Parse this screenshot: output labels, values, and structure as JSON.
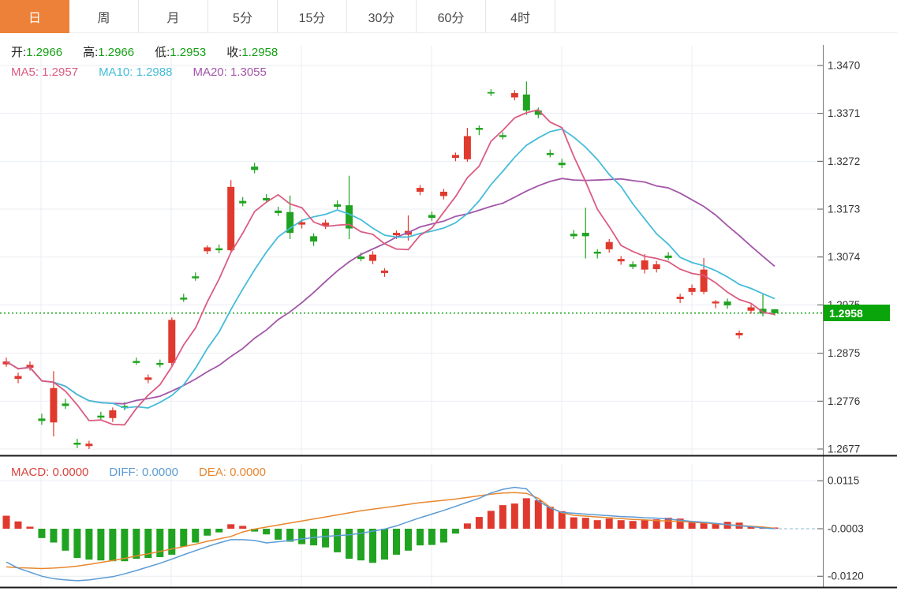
{
  "tabs": [
    {
      "id": "day",
      "label": "日",
      "active": true
    },
    {
      "id": "week",
      "label": "周",
      "active": false
    },
    {
      "id": "month",
      "label": "月",
      "active": false
    },
    {
      "id": "5min",
      "label": "5分",
      "active": false
    },
    {
      "id": "15min",
      "label": "15分",
      "active": false
    },
    {
      "id": "30min",
      "label": "30分",
      "active": false
    },
    {
      "id": "60min",
      "label": "60分",
      "active": false
    },
    {
      "id": "4hour",
      "label": "4时",
      "active": false
    }
  ],
  "legend": {
    "ohlc": [
      {
        "label": "开:",
        "value": "1.2966"
      },
      {
        "label": "高:",
        "value": "1.2966"
      },
      {
        "label": "低:",
        "value": "1.2953"
      },
      {
        "label": "收:",
        "value": "1.2958"
      }
    ],
    "ma": [
      {
        "label": "MA5:",
        "value": "1.2957",
        "color": "#db5c81"
      },
      {
        "label": "MA10:",
        "value": "1.2988",
        "color": "#45bcd9"
      },
      {
        "label": "MA20:",
        "value": "1.3055",
        "color": "#a256a8"
      }
    ],
    "macd": [
      {
        "label": "MACD:",
        "value": "0.0000",
        "color": "#d8453c"
      },
      {
        "label": "DIFF:",
        "value": "0.0000",
        "color": "#5b9bd5"
      },
      {
        "label": "DEA:",
        "value": "0.0000",
        "color": "#e8872e"
      }
    ]
  },
  "price_tag": "1.2958",
  "colors": {
    "up": "#e0392e",
    "down": "#20a320",
    "ma5": "#db5c81",
    "ma10": "#45bcd9",
    "ma20": "#a256a8",
    "diff": "#5b9bd5",
    "dea": "#e8872e",
    "tag": "#0aa50a",
    "grid": "#e9edf2",
    "axis_text": "#333333",
    "ohlc_value": "#16a016",
    "dotted_price": "#12a212",
    "dashed_zero": "#8ab8dd",
    "divider": "#1a1a1a",
    "accent_tab": "#ed8139"
  },
  "chart_data": {
    "type": "candlestick+macd",
    "title": "",
    "legend_note": "red=up green=down, MA5/MA10/MA20 overlays, MACD(12,26,9) sub-panel",
    "price_axis": {
      "ticks": [
        "1.3470",
        "1.3371",
        "1.3272",
        "1.3173",
        "1.3074",
        "1.2975",
        "1.2875",
        "1.2776",
        "1.2677"
      ],
      "min": 1.2677,
      "max": 1.347
    },
    "current_price": 1.2958,
    "candles": [
      [
        1.2852,
        1.2866,
        1.2847,
        1.2858
      ],
      [
        1.2822,
        1.2835,
        1.2813,
        1.2828
      ],
      [
        1.2845,
        1.2858,
        1.2839,
        1.2851
      ],
      [
        1.274,
        1.275,
        1.2727,
        1.2735
      ],
      [
        1.2732,
        1.2838,
        1.2703,
        1.2803
      ],
      [
        1.2771,
        1.2781,
        1.276,
        1.2766
      ],
      [
        1.269,
        1.2698,
        1.2679,
        1.2686
      ],
      [
        1.2683,
        1.2694,
        1.2677,
        1.2688
      ],
      [
        1.2746,
        1.2754,
        1.2738,
        1.2742
      ],
      [
        1.2741,
        1.2763,
        1.2733,
        1.2757
      ],
      [
        1.2766,
        1.2774,
        1.2757,
        1.2762
      ],
      [
        1.2859,
        1.2866,
        1.2851,
        1.2855
      ],
      [
        1.282,
        1.2831,
        1.2813,
        1.2825
      ],
      [
        1.2855,
        1.2862,
        1.2846,
        1.2851
      ],
      [
        1.2855,
        1.2949,
        1.285,
        1.2944
      ],
      [
        1.299,
        1.2998,
        1.2981,
        1.2986
      ],
      [
        1.3034,
        1.3042,
        1.3025,
        1.303
      ],
      [
        1.3086,
        1.3098,
        1.308,
        1.3094
      ],
      [
        1.3092,
        1.31,
        1.3082,
        1.3088
      ],
      [
        1.3088,
        1.3233,
        1.3083,
        1.3219
      ],
      [
        1.319,
        1.3198,
        1.3179,
        1.3185
      ],
      [
        1.3261,
        1.3269,
        1.3247,
        1.3254
      ],
      [
        1.3196,
        1.3204,
        1.3186,
        1.3191
      ],
      [
        1.317,
        1.3178,
        1.3159,
        1.3165
      ],
      [
        1.3167,
        1.3201,
        1.3111,
        1.3124
      ],
      [
        1.3141,
        1.3152,
        1.3133,
        1.3146
      ],
      [
        1.3117,
        1.3123,
        1.3097,
        1.3106
      ],
      [
        1.3139,
        1.3151,
        1.3132,
        1.3145
      ],
      [
        1.3183,
        1.3191,
        1.3173,
        1.3178
      ],
      [
        1.3181,
        1.3242,
        1.3111,
        1.3133
      ],
      [
        1.3075,
        1.3083,
        1.3065,
        1.307
      ],
      [
        1.3066,
        1.3086,
        1.3059,
        1.3079
      ],
      [
        1.3041,
        1.3051,
        1.3033,
        1.3046
      ],
      [
        1.3119,
        1.3129,
        1.3111,
        1.3124
      ],
      [
        1.312,
        1.316,
        1.3108,
        1.3128
      ],
      [
        1.3209,
        1.3223,
        1.3202,
        1.3217
      ],
      [
        1.3161,
        1.3168,
        1.3149,
        1.3155
      ],
      [
        1.32,
        1.3215,
        1.3193,
        1.3209
      ],
      [
        1.3279,
        1.329,
        1.3272,
        1.3285
      ],
      [
        1.3276,
        1.3341,
        1.3271,
        1.3324
      ],
      [
        1.3341,
        1.3346,
        1.3326,
        1.3337
      ],
      [
        1.3415,
        1.3421,
        1.3407,
        1.3412
      ],
      [
        1.3326,
        1.3332,
        1.3317,
        1.3322
      ],
      [
        1.3404,
        1.3419,
        1.3398,
        1.3413
      ],
      [
        1.341,
        1.3437,
        1.3368,
        1.3377
      ],
      [
        1.3377,
        1.3383,
        1.3361,
        1.3368
      ],
      [
        1.3289,
        1.3296,
        1.328,
        1.3285
      ],
      [
        1.3269,
        1.3277,
        1.3258,
        1.3264
      ],
      [
        1.3122,
        1.313,
        1.3111,
        1.3117
      ],
      [
        1.3124,
        1.3176,
        1.3071,
        1.3117
      ],
      [
        1.3085,
        1.309,
        1.3071,
        1.3081
      ],
      [
        1.309,
        1.3111,
        1.3083,
        1.3105
      ],
      [
        1.3065,
        1.3076,
        1.3058,
        1.307
      ],
      [
        1.3059,
        1.3065,
        1.3049,
        1.3054
      ],
      [
        1.3048,
        1.308,
        1.304,
        1.3067
      ],
      [
        1.3049,
        1.3066,
        1.3042,
        1.3059
      ],
      [
        1.3077,
        1.3084,
        1.3068,
        1.3072
      ],
      [
        1.2987,
        1.2998,
        1.2979,
        1.2992
      ],
      [
        1.3002,
        1.3017,
        1.2995,
        1.301
      ],
      [
        1.3002,
        1.3072,
        1.2997,
        1.3048
      ],
      [
        1.2978,
        1.2985,
        1.2968,
        1.2982
      ],
      [
        1.2982,
        1.2988,
        1.2967,
        1.2974
      ],
      [
        1.2912,
        1.2922,
        1.2905,
        1.2917
      ],
      [
        1.2963,
        1.2976,
        1.2957,
        1.297
      ],
      [
        1.2967,
        1.2998,
        1.2951,
        1.2957
      ],
      [
        1.2966,
        1.2966,
        1.2953,
        1.2958
      ]
    ],
    "ma_periods": [
      5,
      10,
      20
    ],
    "macd": {
      "axis_ticks": [
        "0.0115",
        "-0.0003",
        "-0.0120"
      ],
      "hist": [
        0.0029,
        0.0015,
        0.0002,
        -0.0026,
        -0.0037,
        -0.0057,
        -0.0075,
        -0.0079,
        -0.0081,
        -0.0083,
        -0.0083,
        -0.0077,
        -0.0075,
        -0.0073,
        -0.0067,
        -0.0047,
        -0.0037,
        -0.002,
        -0.0012,
        0.0008,
        0.0004,
        -0.001,
        -0.0017,
        -0.003,
        -0.0035,
        -0.0041,
        -0.0044,
        -0.0049,
        -0.0061,
        -0.0077,
        -0.0081,
        -0.0087,
        -0.0079,
        -0.0067,
        -0.0057,
        -0.0044,
        -0.0043,
        -0.0037,
        -0.0015,
        0.001,
        0.0026,
        0.0041,
        0.0055,
        0.0059,
        0.0072,
        0.0067,
        0.0051,
        0.004,
        0.0025,
        0.0024,
        0.0018,
        0.0022,
        0.0018,
        0.0016,
        0.0018,
        0.002,
        0.0024,
        0.0022,
        0.0015,
        0.0012,
        0.001,
        0.0014,
        0.0012,
        0.0003,
        0.0001,
        0.0
      ],
      "diff": [
        -0.0085,
        -0.01,
        -0.011,
        -0.012,
        -0.0126,
        -0.0129,
        -0.0131,
        -0.0129,
        -0.0125,
        -0.0121,
        -0.0114,
        -0.0106,
        -0.0097,
        -0.0088,
        -0.0078,
        -0.0067,
        -0.0057,
        -0.0047,
        -0.0038,
        -0.003,
        -0.003,
        -0.0032,
        -0.0038,
        -0.0035,
        -0.0032,
        -0.0028,
        -0.0025,
        -0.0022,
        -0.002,
        -0.0018,
        -0.0014,
        -0.0009,
        -0.0004,
        0.0004,
        0.0014,
        0.0024,
        0.0033,
        0.0042,
        0.0052,
        0.0062,
        0.0072,
        0.0085,
        0.0094,
        0.0099,
        0.0095,
        0.0065,
        0.0048,
        0.0037,
        0.0035,
        0.0033,
        0.0031,
        0.0029,
        0.0027,
        0.0026,
        0.0024,
        0.0023,
        0.0021,
        0.0018,
        0.0015,
        0.0013,
        0.001,
        0.0007,
        0.0004,
        0.0002,
        -0.0001,
        -0.0003
      ],
      "dea": [
        -0.0097,
        -0.0099,
        -0.01,
        -0.0101,
        -0.01,
        -0.0098,
        -0.0095,
        -0.0091,
        -0.0086,
        -0.0081,
        -0.0076,
        -0.007,
        -0.0065,
        -0.0059,
        -0.0053,
        -0.0047,
        -0.0041,
        -0.0034,
        -0.0028,
        -0.0022,
        -0.0011,
        -0.0004,
        0.0001,
        0.0006,
        0.0011,
        0.0016,
        0.0021,
        0.0026,
        0.0031,
        0.0036,
        0.0041,
        0.0045,
        0.0049,
        0.0053,
        0.0057,
        0.0061,
        0.0064,
        0.0067,
        0.007,
        0.0074,
        0.0078,
        0.0082,
        0.0085,
        0.0086,
        0.0084,
        0.0072,
        0.005,
        0.0036,
        0.003,
        0.0028,
        0.0026,
        0.0024,
        0.0022,
        0.002,
        0.0019,
        0.0017,
        0.0016,
        0.0015,
        0.0013,
        0.0011,
        0.0009,
        0.0007,
        0.0005,
        0.0003,
        0.0001,
        -0.0002
      ]
    },
    "grid": {
      "vertical_x": [
        52,
        217,
        382,
        547,
        712,
        877
      ]
    }
  }
}
